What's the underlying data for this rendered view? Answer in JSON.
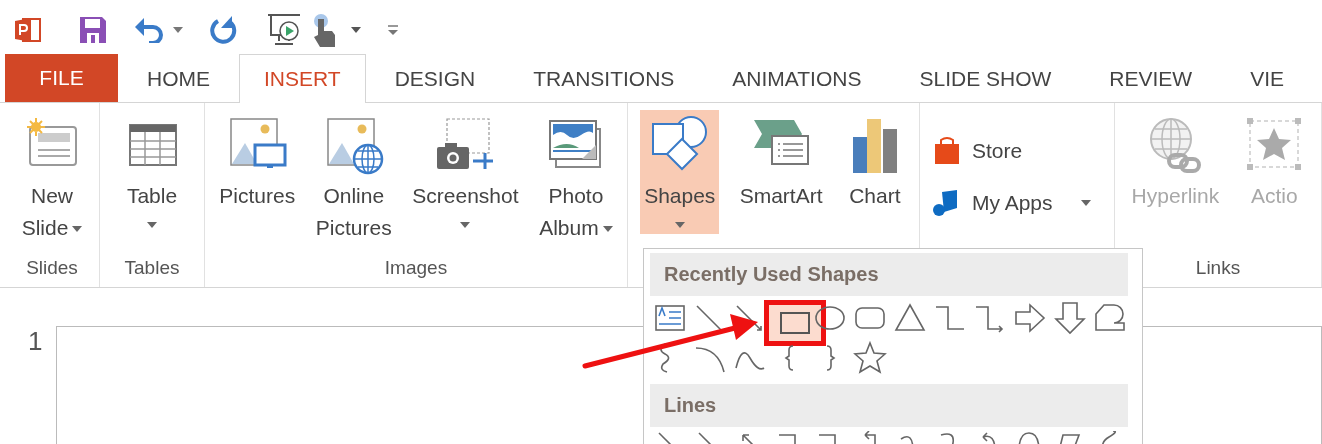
{
  "tabs": [
    {
      "label": "FILE",
      "kind": "file",
      "selected": false
    },
    {
      "label": "HOME",
      "kind": "tab",
      "selected": false
    },
    {
      "label": "INSERT",
      "kind": "tab",
      "selected": true
    },
    {
      "label": "DESIGN",
      "kind": "tab",
      "selected": false
    },
    {
      "label": "TRANSITIONS",
      "kind": "tab",
      "selected": false
    },
    {
      "label": "ANIMATIONS",
      "kind": "tab",
      "selected": false
    },
    {
      "label": "SLIDE SHOW",
      "kind": "tab",
      "selected": false
    },
    {
      "label": "REVIEW",
      "kind": "tab",
      "selected": false
    },
    {
      "label": "VIE",
      "kind": "tab",
      "selected": false
    }
  ],
  "ribbon_groups": [
    {
      "label": "Slides",
      "commands": [
        {
          "kind": "large",
          "label": "New\nSlide",
          "dropdown": true,
          "pressed": false,
          "disabled": false
        }
      ]
    },
    {
      "label": "Tables",
      "commands": [
        {
          "kind": "large",
          "label": "Table",
          "dropdown": true,
          "pressed": false,
          "disabled": false
        }
      ]
    },
    {
      "label": "Images",
      "commands": [
        {
          "kind": "large",
          "label": "Pictures",
          "dropdown": false,
          "pressed": false,
          "disabled": false
        },
        {
          "kind": "large",
          "label": "Online\nPictures",
          "dropdown": false,
          "pressed": false,
          "disabled": false
        },
        {
          "kind": "large",
          "label": "Screenshot",
          "dropdown": true,
          "pressed": false,
          "disabled": false
        },
        {
          "kind": "large",
          "label": "Photo\nAlbum",
          "dropdown": true,
          "pressed": false,
          "disabled": false
        }
      ]
    },
    {
      "commands": [
        {
          "kind": "large",
          "label": "Shapes",
          "dropdown": true,
          "pressed": true,
          "disabled": false
        },
        {
          "kind": "large",
          "label": "SmartArt",
          "dropdown": false,
          "pressed": false,
          "disabled": false
        },
        {
          "kind": "large",
          "label": "Chart",
          "dropdown": false,
          "pressed": false,
          "disabled": false
        }
      ]
    },
    {
      "commands": [
        {
          "kind": "small",
          "label": "Store",
          "dropdown": false,
          "pressed": false,
          "disabled": false
        },
        {
          "kind": "small",
          "label": "My Apps",
          "dropdown": true,
          "pressed": false,
          "disabled": false
        }
      ]
    },
    {
      "label": "Links",
      "commands": [
        {
          "kind": "large",
          "label": "Hyperlink",
          "dropdown": false,
          "pressed": false,
          "disabled": true
        },
        {
          "kind": "large",
          "label": "Actio",
          "dropdown": false,
          "pressed": false,
          "disabled": true
        }
      ]
    }
  ],
  "slides": [
    {
      "number": "1"
    }
  ],
  "shapes_gallery": {
    "sections": [
      {
        "title": "Recently Used Shapes",
        "items": [
          {
            "selected": false
          },
          {
            "selected": false
          },
          {
            "selected": false
          },
          {
            "selected": true
          },
          {
            "selected": false
          },
          {
            "selected": false
          },
          {
            "selected": false
          },
          {
            "selected": false
          },
          {
            "selected": false
          },
          {
            "selected": false
          },
          {
            "selected": false
          },
          {
            "selected": false
          },
          {
            "selected": false
          },
          {
            "selected": false
          },
          {
            "selected": false
          },
          {
            "selected": false
          },
          {
            "selected": false
          },
          {
            "selected": false
          }
        ]
      },
      {
        "title": "Lines",
        "items": [
          {
            "selected": false
          },
          {
            "selected": false
          },
          {
            "selected": false
          },
          {
            "selected": false
          },
          {
            "selected": false
          },
          {
            "selected": false
          },
          {
            "selected": false
          },
          {
            "selected": false
          },
          {
            "selected": false
          },
          {
            "selected": false
          },
          {
            "selected": false
          },
          {
            "selected": false
          }
        ]
      }
    ]
  }
}
